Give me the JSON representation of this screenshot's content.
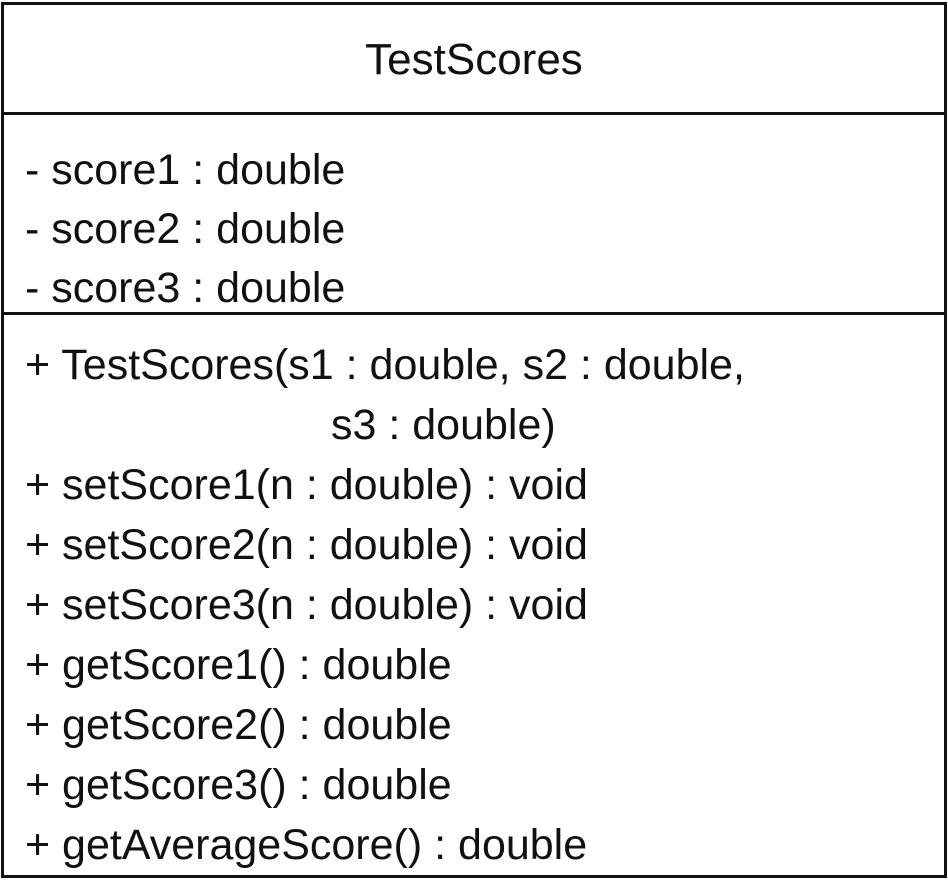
{
  "class_name": "TestScores",
  "attributes": [
    "- score1 : double",
    "- score2 : double",
    "- score3 : double"
  ],
  "operations": [
    "+ TestScores(s1 : double, s2 : double,",
    "s3 : double)",
    "+ setScore1(n : double) : void",
    "+ setScore2(n : double) : void",
    "+ setScore3(n : double) : void",
    "+ getScore1() : double",
    "+ getScore2() : double",
    "+ getScore3() : double",
    "+ getAverageScore() : double"
  ]
}
